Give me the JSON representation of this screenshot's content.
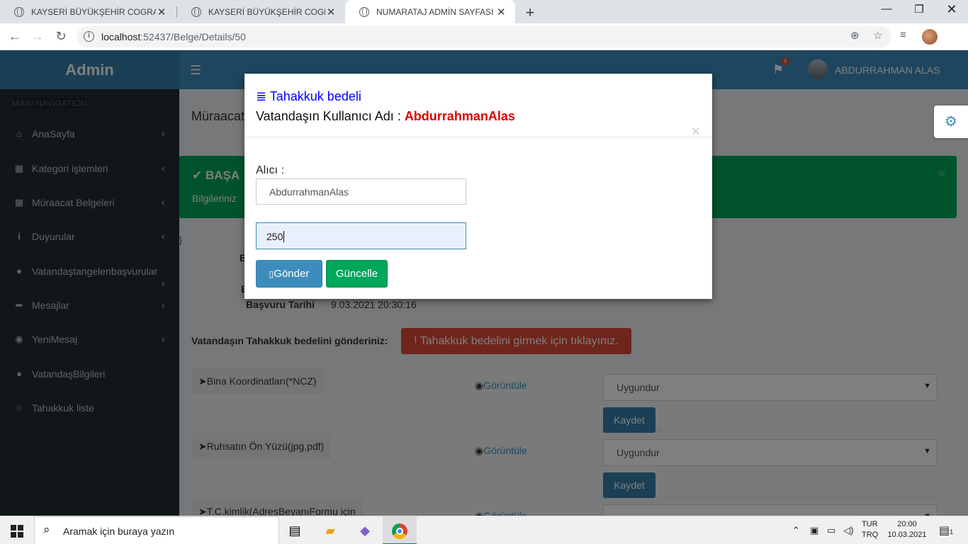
{
  "browser": {
    "tabs": [
      {
        "title": "KAYSERİ BÜYÜKŞEHİR COGRAFİ BİLGİ",
        "active": false
      },
      {
        "title": "KAYSERİ BÜYÜKŞEHİR COGRAFİ BİLGİ",
        "active": false
      },
      {
        "title": "NUMARATAJ ADMİN SAYFASI",
        "active": true
      }
    ],
    "url_host": "localhost",
    "url_path": ":52437/Belge/Details/50"
  },
  "app": {
    "logo": "Admin",
    "user_name": "ABDURRAHMAN ALAS",
    "flag_badge": "9"
  },
  "sidebar": {
    "header": "MAIN NAVIGATION",
    "items": [
      {
        "label": "AnaSayfa",
        "icon": "home-icon",
        "chevron": true
      },
      {
        "label": "Kategori işlemleri",
        "icon": "table-icon",
        "chevron": true
      },
      {
        "label": "Müraacat Belgeleri",
        "icon": "table-icon",
        "chevron": true
      },
      {
        "label": "Duyurular",
        "icon": "info-icon",
        "chevron": true
      },
      {
        "label": "Vatandaştangelenbaşvurular",
        "icon": "user-icon",
        "chevron": true
      },
      {
        "label": "Mesajlar",
        "icon": "share-icon",
        "chevron": true
      },
      {
        "label": "YeniMesaj",
        "icon": "gamepad-icon",
        "chevron": true
      },
      {
        "label": "VatandaşBilgileri",
        "icon": "user-icon",
        "chevron": false
      },
      {
        "label": "Tahakkuk liste",
        "icon": "circle-icon",
        "chevron": false
      }
    ]
  },
  "content": {
    "page_title": "Müraacat",
    "alert_title": "BAŞA",
    "alert_text": "Bilgileriniz",
    "stray_brace": "}",
    "label_b": "B",
    "label_e": "E",
    "apply_date_label": "Başvuru Tarihi",
    "apply_date_value": "9.03.2021 20:30:16",
    "tahakkuk_prompt": "Vatandaşın Tahakkuk bedelini gönderiniz:",
    "tahakkuk_button": "! Tahakkuk bedelini girmek için tıklayınız.",
    "documents": [
      {
        "name": "➤Bina Koordinatları(*NCZ)",
        "view": "Görüntüle",
        "status": "Uygundur",
        "save": "Kaydet"
      },
      {
        "name": "➤Ruhsatın Ön Yüzü(jpg,pdf)",
        "view": "Görüntüle",
        "status": "Uygundur",
        "save": "Kaydet"
      },
      {
        "name": "➤T.C.kimlik(AdresBeyanıFormu için",
        "view": "Görüntüle",
        "status": "",
        "save": "Kaydet"
      }
    ]
  },
  "modal": {
    "title": "≣ Tahakkuk bedeli",
    "subtitle_prefix": "Vatandaşın Kullanıcı Adı : ",
    "subtitle_user": "AbdurrahmanAlas",
    "recipient_label": "Alıcı :",
    "recipient_value": "AbdurrahmanAlas",
    "amount_value": "250",
    "send_button": "Gönder",
    "update_button": "Güncelle"
  },
  "taskbar": {
    "search_placeholder": "Aramak için buraya yazın",
    "lang_1": "TUR",
    "lang_2": "TRQ",
    "time": "20:00",
    "date": "10.03.2021",
    "notif_count": "1"
  },
  "colors": {
    "primary": "#3c8dbc",
    "success": "#00a65a",
    "danger": "#dd4b39",
    "sidebar": "#222d32",
    "modal_title": "#0000ff",
    "username_red": "#e00000"
  }
}
